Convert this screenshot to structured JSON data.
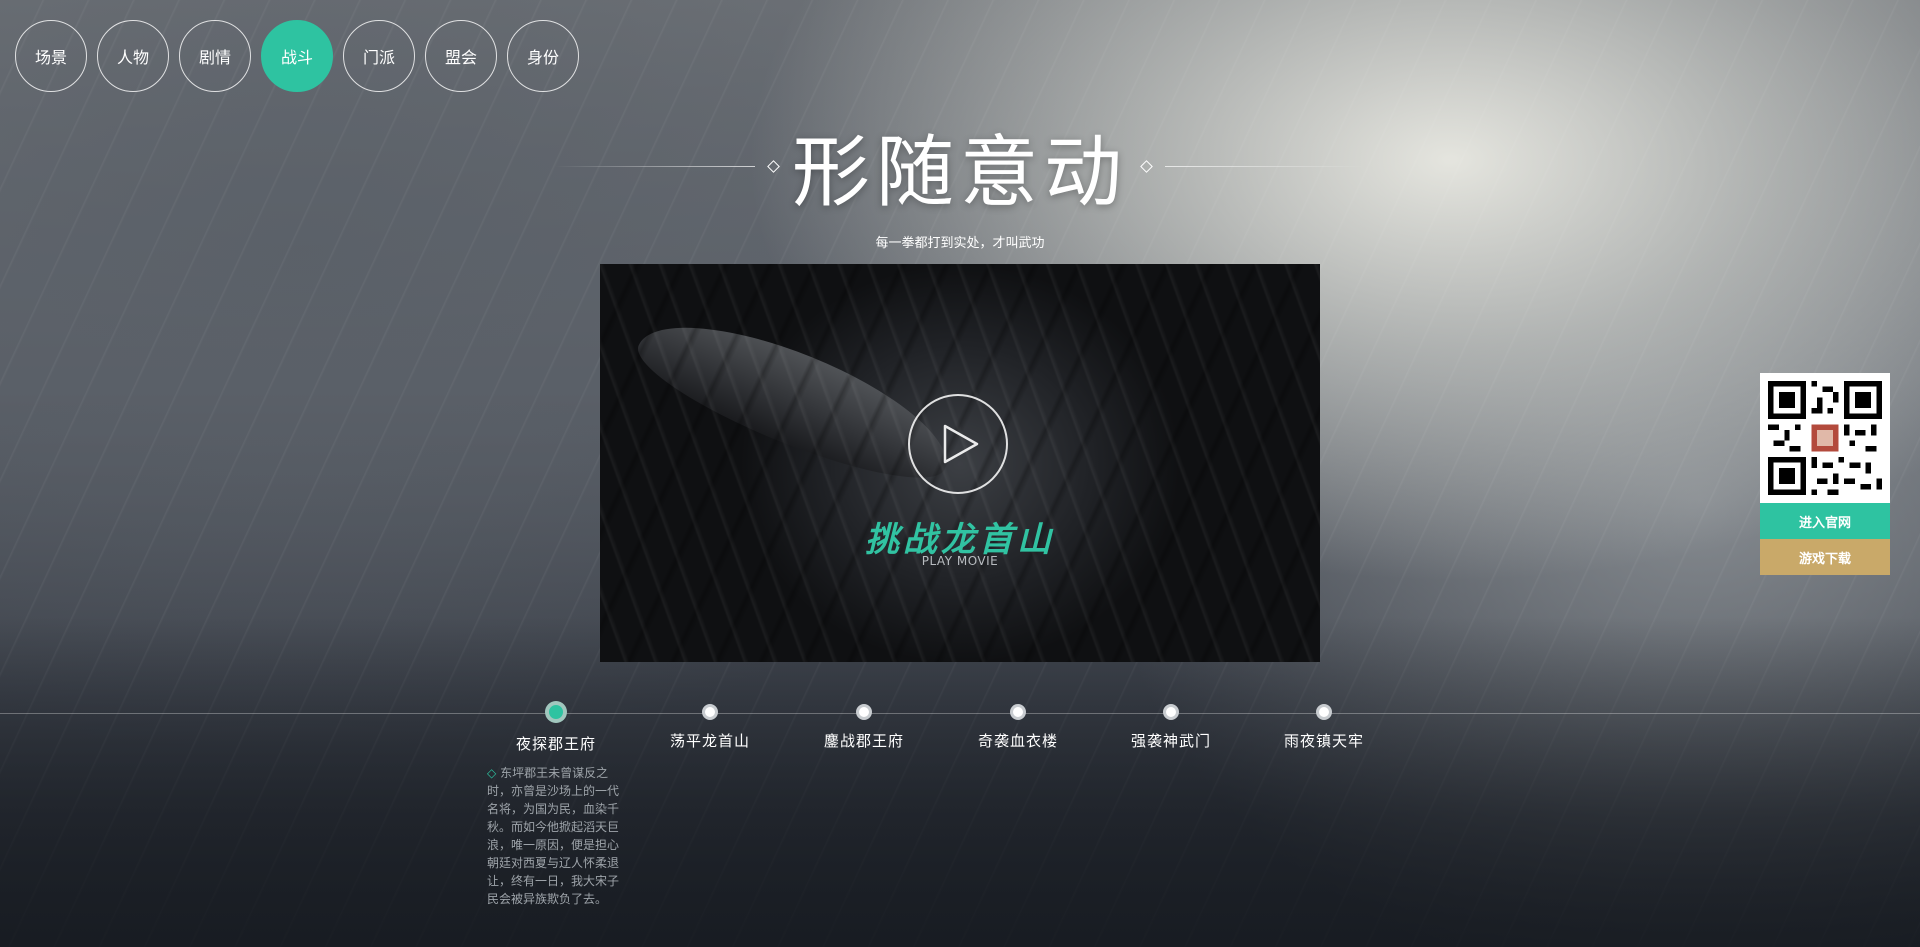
{
  "nav": {
    "items": [
      {
        "label": "场景",
        "active": false
      },
      {
        "label": "人物",
        "active": false
      },
      {
        "label": "剧情",
        "active": false
      },
      {
        "label": "战斗",
        "active": true
      },
      {
        "label": "门派",
        "active": false
      },
      {
        "label": "盟会",
        "active": false
      },
      {
        "label": "身份",
        "active": false
      }
    ]
  },
  "heading": {
    "title": "形随意动",
    "subtitle": "每一拳都打到实处，才叫武功"
  },
  "video": {
    "title": "挑战龙首山",
    "subtitle": "PLAY MOVIE",
    "play_icon": "play-icon"
  },
  "timeline": {
    "items": [
      {
        "label": "夜探郡王府",
        "active": true
      },
      {
        "label": "荡平龙首山",
        "active": false
      },
      {
        "label": "鏖战郡王府",
        "active": false
      },
      {
        "label": "奇袭血衣楼",
        "active": false
      },
      {
        "label": "强袭神武门",
        "active": false
      },
      {
        "label": "雨夜镇天牢",
        "active": false
      }
    ],
    "description_marker": "◇",
    "description": "东坪郡王未曾谋反之时，亦曾是沙场上的一代名将，为国为民，血染千秋。而如今他掀起滔天巨浪，唯一原因，便是担心朝廷对西夏与辽人怀柔退让，终有一日，我大宋子民会被异族欺负了去。"
  },
  "side_panel": {
    "qr_icon": "qr-code-icon",
    "official_site_label": "进入官网",
    "download_label": "游戏下载"
  },
  "colors": {
    "accent": "#2ec3a1",
    "download": "#c9a969"
  }
}
